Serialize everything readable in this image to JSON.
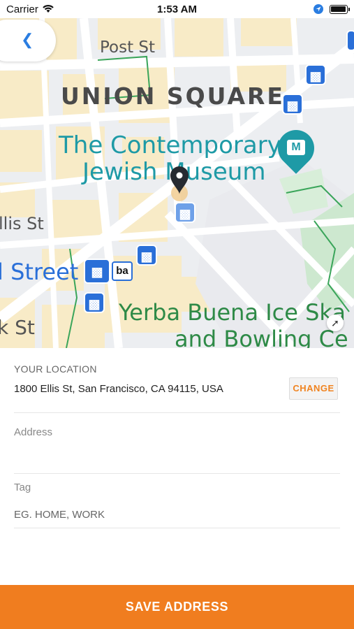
{
  "status_bar": {
    "carrier": "Carrier",
    "time": "1:53 AM"
  },
  "map": {
    "labels": {
      "post_st": "Post St",
      "union_square": "UNION SQUARE",
      "museum_line1": "The Contemporary",
      "museum_line2": "Jewish Museum",
      "ellis_st": "llis St",
      "market_street": "l Street",
      "yerba_line1": "Yerba Buena Ice Ska",
      "yerba_line2": "and Bowling Ce",
      "k_st": "k St",
      "bart": "ba"
    }
  },
  "location": {
    "heading": "YOUR LOCATION",
    "address": "1800 Ellis St, San Francisco, CA 94115, USA",
    "change_label": "CHANGE"
  },
  "address_field": {
    "label": "Address",
    "value": "",
    "placeholder": ""
  },
  "tag_field": {
    "label": "Tag",
    "placeholder": "EG. HOME, WORK"
  },
  "save_label": "SAVE ADDRESS",
  "colors": {
    "accent": "#f07d1f",
    "link": "#2a7de1",
    "transit": "#2a6fd8",
    "museum": "#1e9aa6",
    "park": "#2e8a47"
  }
}
